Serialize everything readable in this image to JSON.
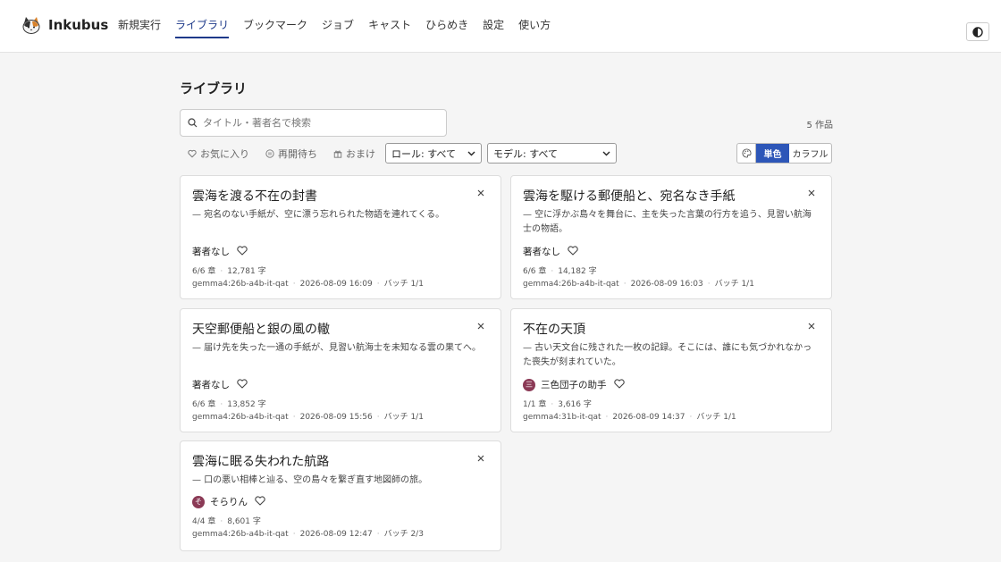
{
  "app": {
    "name": "Inkubus"
  },
  "nav": [
    "新規実行",
    "ライブラリ",
    "ブックマーク",
    "ジョブ",
    "キャスト",
    "ひらめき",
    "設定",
    "使い方"
  ],
  "nav_active": 1,
  "page": {
    "title": "ライブラリ",
    "search_placeholder": "タイトル・著者名で検索",
    "count": "5 作品"
  },
  "filters": {
    "favorite": "お気に入り",
    "resume": "再開待ち",
    "bonus": "おまけ",
    "role_select": "ロール: すべて",
    "model_select": "モデル: すべて"
  },
  "color_mode": {
    "mono": "単色",
    "color": "カラフル",
    "selected": "mono"
  },
  "colors": {
    "accent": "#2d56b8",
    "nav_active": "#1e3a8a",
    "avatar": "#8b3a56"
  },
  "works": [
    {
      "title": "雲海を渡る不在の封書",
      "desc": "— 宛名のない手紙が、空に漂う忘れられた物語を連れてくる。",
      "author": "著者なし",
      "avatar": "",
      "chapters": "6/6 章",
      "chars": "12,781 字",
      "model": "gemma4:26b-a4b-it-qat",
      "date": "2026-08-09 16:09",
      "batch": "バッチ 1/1"
    },
    {
      "title": "雲海を駆ける郵便船と、宛名なき手紙",
      "desc": "— 空に浮かぶ島々を舞台に、主を失った言葉の行方を追う、見習い航海士の物語。",
      "author": "著者なし",
      "avatar": "",
      "chapters": "6/6 章",
      "chars": "14,182 字",
      "model": "gemma4:26b-a4b-it-qat",
      "date": "2026-08-09 16:03",
      "batch": "バッチ 1/1"
    },
    {
      "title": "天空郵便船と銀の風の轍",
      "desc": "— 届け先を失った一通の手紙が、見習い航海士を未知なる雲の果てへ。",
      "author": "著者なし",
      "avatar": "",
      "chapters": "6/6 章",
      "chars": "13,852 字",
      "model": "gemma4:26b-a4b-it-qat",
      "date": "2026-08-09 15:56",
      "batch": "バッチ 1/1"
    },
    {
      "title": "不在の天頂",
      "desc": "— 古い天文台に残された一枚の記録。そこには、誰にも気づかれなかった喪失が刻まれていた。",
      "author": "三色団子の助手",
      "avatar": "三",
      "chapters": "1/1 章",
      "chars": "3,616 字",
      "model": "gemma4:31b-it-qat",
      "date": "2026-08-09 14:37",
      "batch": "バッチ 1/1"
    },
    {
      "title": "雲海に眠る失われた航路",
      "desc": "— 口の悪い相棒と辿る、空の島々を繋ぎ直す地図師の旅。",
      "author": "そらりん",
      "avatar": "そ",
      "chapters": "4/4 章",
      "chars": "8,601 字",
      "model": "gemma4:26b-a4b-it-qat",
      "date": "2026-08-09 12:47",
      "batch": "バッチ 2/3"
    }
  ]
}
